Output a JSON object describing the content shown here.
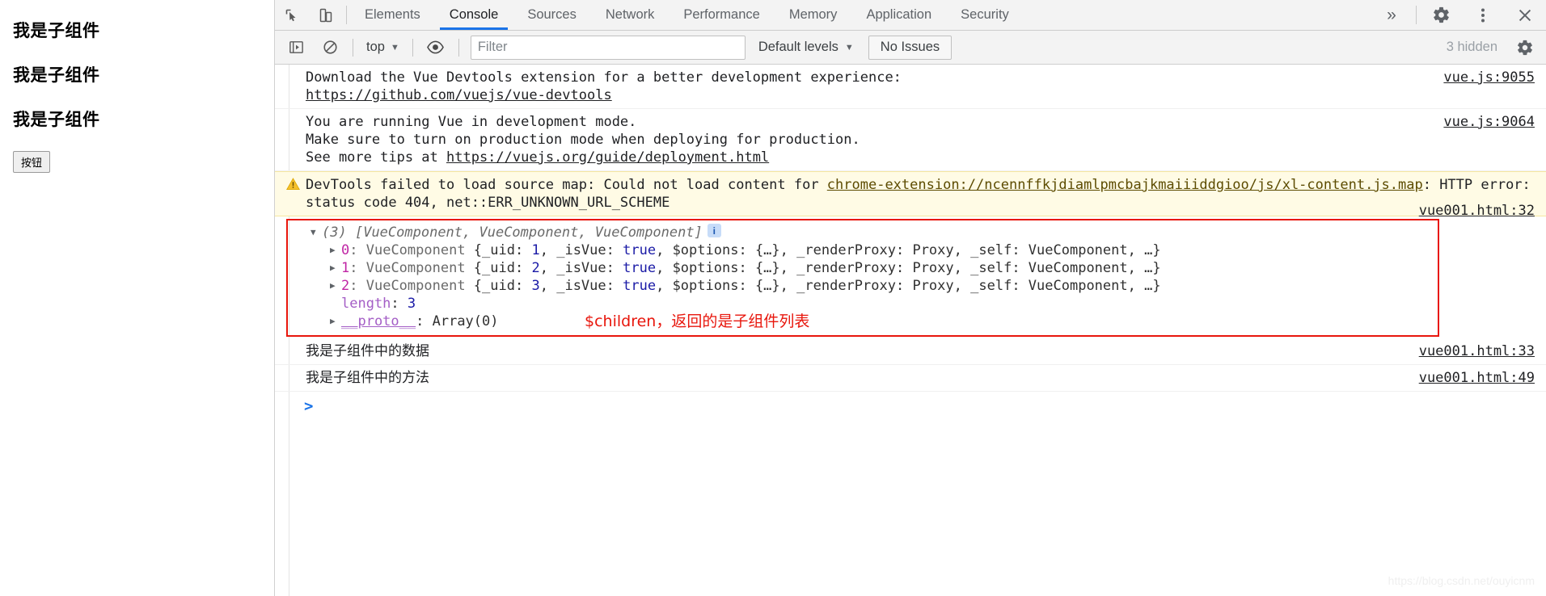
{
  "page_pane": {
    "headings": [
      "我是子组件",
      "我是子组件",
      "我是子组件"
    ],
    "button_label": "按钮"
  },
  "devtools": {
    "tabs": [
      {
        "label": "Elements",
        "active": false
      },
      {
        "label": "Console",
        "active": true
      },
      {
        "label": "Sources",
        "active": false
      },
      {
        "label": "Network",
        "active": false
      },
      {
        "label": "Performance",
        "active": false
      },
      {
        "label": "Memory",
        "active": false
      },
      {
        "label": "Application",
        "active": false
      },
      {
        "label": "Security",
        "active": false
      }
    ],
    "more_tabs_label": "»",
    "icons": {
      "inspect": "inspect-cursor-icon",
      "device": "device-toolbar-icon",
      "settings": "gear-icon",
      "menu": "three-dot-menu-icon",
      "close": "close-icon"
    },
    "accent_color": "#1a73e8"
  },
  "console_toolbar": {
    "sidebar_toggle": "console-sidebar-icon",
    "clear_label": "clear-console-icon",
    "context": "top",
    "eye_label": "live-expression-icon",
    "filter_placeholder": "Filter",
    "filter_value": "",
    "levels_label": "Default levels",
    "issues_label": "No Issues",
    "hidden_label": "3 hidden",
    "settings_label": "console-settings-icon"
  },
  "console_messages": [
    {
      "id": "vue-devtools",
      "type": "log",
      "text_before": "Download the Vue Devtools extension for a better development experience:\n",
      "link": "https://github.com/vuejs/vue-devtools",
      "text_after": "",
      "source": "vue.js:9055"
    },
    {
      "id": "vue-dev-mode",
      "type": "log",
      "text_before": "You are running Vue in development mode.\nMake sure to turn on production mode when deploying for production.\nSee more tips at ",
      "link": "https://vuejs.org/guide/deployment.html",
      "text_after": "",
      "source": "vue.js:9064"
    },
    {
      "id": "source-map-warning",
      "type": "warning",
      "text_before": "DevTools failed to load source map: Could not load content for ",
      "link": "chrome-extension://ncennffkjdiamlpmcbajkmaiiiddgioo/js/xl-content.js.map",
      "text_after": ": HTTP error: status code 404, net::ERR_UNKNOWN_URL_SCHEME",
      "source": ""
    }
  ],
  "array_group": {
    "source": "vue001.html:32",
    "header": {
      "triangle": "▼",
      "count": "(3)",
      "preview": "[VueComponent, VueComponent, VueComponent]",
      "info_badge": "i"
    },
    "items": [
      {
        "triangle": "▶",
        "index": "0",
        "ctor": "VueComponent",
        "uid_key": "_uid",
        "uid": "1",
        "isvue_key": "_isVue",
        "isvue": "true",
        "options_key": "$options",
        "options": "{…}",
        "proxy_key": "_renderProxy",
        "proxy": "Proxy",
        "self_key": "_self",
        "self": "VueComponent",
        "ellipsis": "…}"
      },
      {
        "triangle": "▶",
        "index": "1",
        "ctor": "VueComponent",
        "uid_key": "_uid",
        "uid": "2",
        "isvue_key": "_isVue",
        "isvue": "true",
        "options_key": "$options",
        "options": "{…}",
        "proxy_key": "_renderProxy",
        "proxy": "Proxy",
        "self_key": "_self",
        "self": "VueComponent",
        "ellipsis": "…}"
      },
      {
        "triangle": "▶",
        "index": "2",
        "ctor": "VueComponent",
        "uid_key": "_uid",
        "uid": "3",
        "isvue_key": "_isVue",
        "isvue": "true",
        "options_key": "$options",
        "options": "{…}",
        "proxy_key": "_renderProxy",
        "proxy": "Proxy",
        "self_key": "_self",
        "self": "VueComponent",
        "ellipsis": "…}"
      }
    ],
    "length_key": "length",
    "length_value": "3",
    "proto_triangle": "▶",
    "proto_key": "__proto__",
    "proto_value": "Array(0)",
    "annotation": "$children，返回的是子组件列表",
    "annotation_color": "#e8160c",
    "border_color": "#e8160c"
  },
  "tail_messages": [
    {
      "text": "我是子组件中的数据",
      "source": "vue001.html:33"
    },
    {
      "text": "我是子组件中的方法",
      "source": "vue001.html:49"
    }
  ],
  "prompt": {
    "chevron": ">",
    "value": ""
  },
  "watermark": "https://blog.csdn.net/ouyicnm"
}
